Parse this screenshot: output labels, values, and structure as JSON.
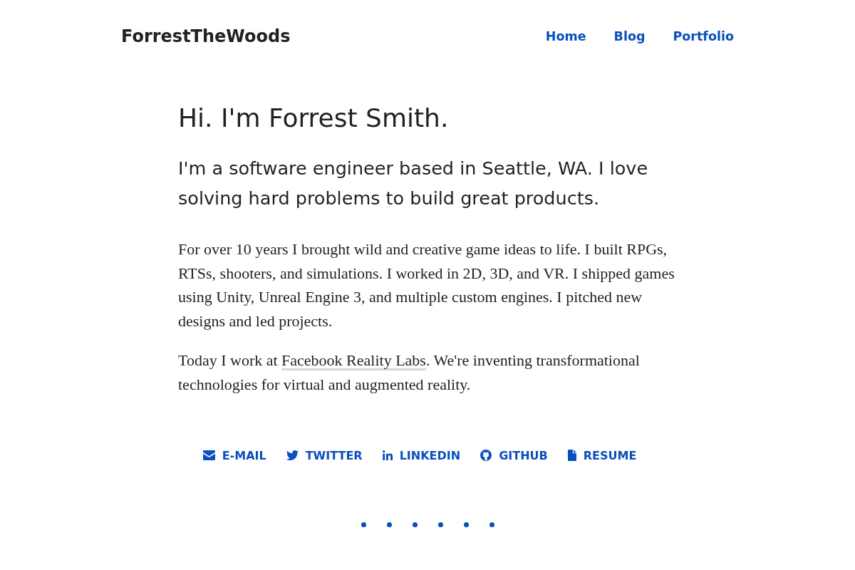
{
  "header": {
    "site_title": "ForrestTheWoods",
    "nav": [
      "Home",
      "Blog",
      "Portfolio"
    ]
  },
  "intro": {
    "heading": "Hi. I'm Forrest Smith.",
    "tagline": "I'm a software engineer based in Seattle, WA. I love solving hard problems to build great products.",
    "paragraphs": [
      [
        {
          "kind": "text",
          "text": "For over 10 years I brought wild and creative game ideas to life. I built RPGs, RTSs, shooters, and simulations. I worked in 2D, 3D, and VR. I shipped games using Unity, Unreal Engine 3, and multiple custom engines. I pitched new designs and led projects."
        }
      ],
      [
        {
          "kind": "text",
          "text": "Today I work at "
        },
        {
          "kind": "link",
          "text": "Facebook Reality Labs"
        },
        {
          "kind": "text",
          "text": ". We're inventing transformational technologies for virtual and augmented reality."
        }
      ]
    ]
  },
  "social_links": [
    {
      "kind": "email",
      "label": "E-MAIL"
    },
    {
      "kind": "twitter",
      "label": "TWITTER"
    },
    {
      "kind": "linkedin",
      "label": "LINKEDIN"
    },
    {
      "kind": "github",
      "label": "GITHUB"
    },
    {
      "kind": "resume",
      "label": "RESUME"
    }
  ]
}
